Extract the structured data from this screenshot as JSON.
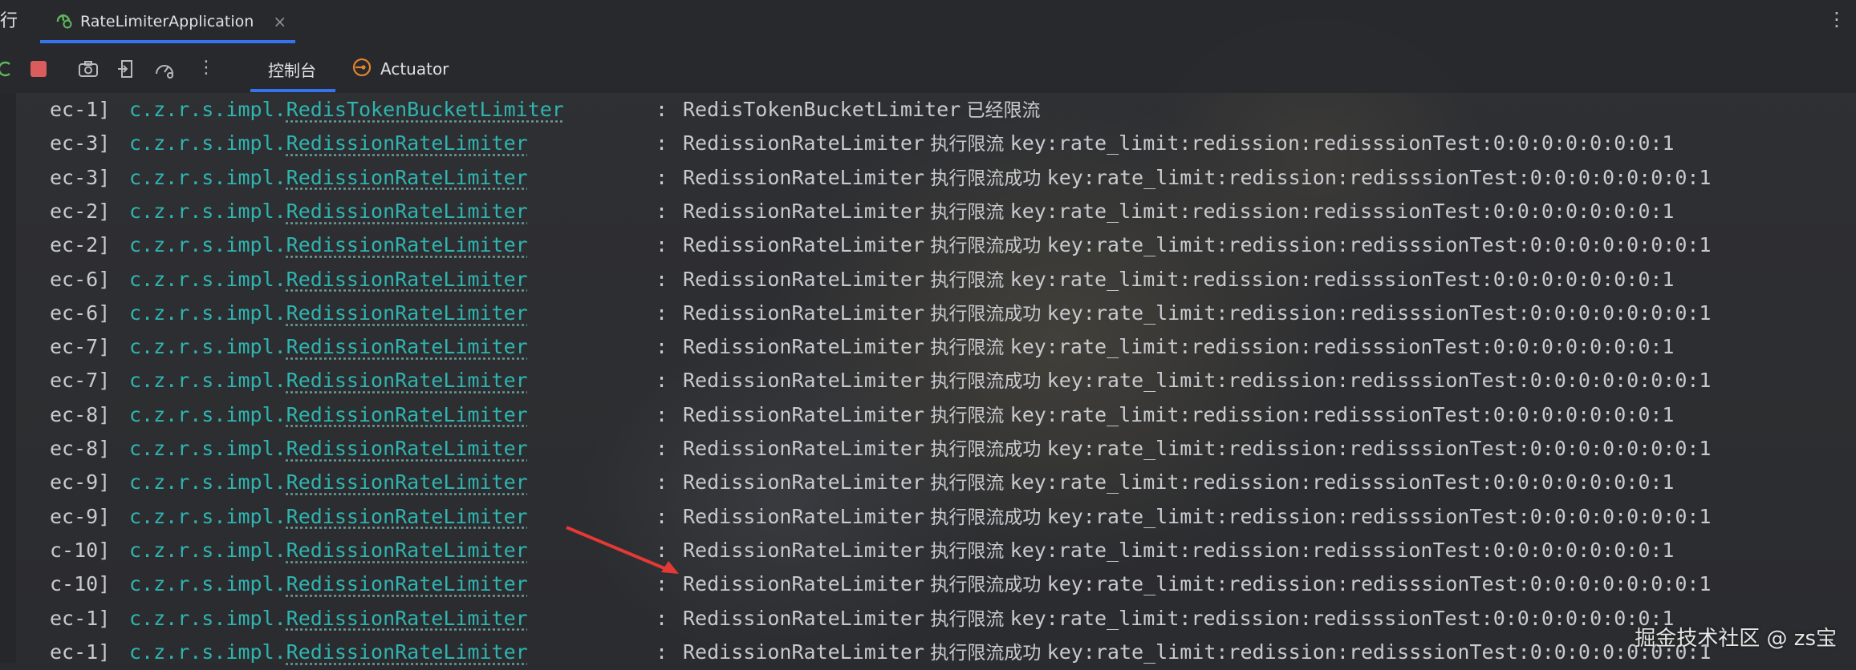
{
  "topbar": {
    "run_label": "行",
    "tab_title": "RateLimiterApplication",
    "tab_close": "×",
    "more": "⋮"
  },
  "toolbar": {
    "more": "⋮",
    "tabs": [
      {
        "label": "控制台",
        "active": true
      },
      {
        "label": "Actuator",
        "active": false
      }
    ]
  },
  "console": {
    "lines": [
      {
        "thread": "ec-1]",
        "pkg": "c.z.r.s.impl.",
        "cls": "RedisTokenBucketLimiter",
        "sep": ":",
        "msg": "RedisTokenBucketLimiter",
        "cjk": " 已经限流",
        "tail": ""
      },
      {
        "thread": "ec-3]",
        "pkg": "c.z.r.s.impl.",
        "cls": "RedissionRateLimiter",
        "sep": ":",
        "msg": "RedissionRateLimiter",
        "cjk": " 执行限流 ",
        "tail": "key:rate_limit:redission:redisssionTest:0:0:0:0:0:0:0:1"
      },
      {
        "thread": "ec-3]",
        "pkg": "c.z.r.s.impl.",
        "cls": "RedissionRateLimiter",
        "sep": ":",
        "msg": "RedissionRateLimiter",
        "cjk": " 执行限流成功 ",
        "tail": "key:rate_limit:redission:redisssionTest:0:0:0:0:0:0:0:1"
      },
      {
        "thread": "ec-2]",
        "pkg": "c.z.r.s.impl.",
        "cls": "RedissionRateLimiter",
        "sep": ":",
        "msg": "RedissionRateLimiter",
        "cjk": " 执行限流 ",
        "tail": "key:rate_limit:redission:redisssionTest:0:0:0:0:0:0:0:1"
      },
      {
        "thread": "ec-2]",
        "pkg": "c.z.r.s.impl.",
        "cls": "RedissionRateLimiter",
        "sep": ":",
        "msg": "RedissionRateLimiter",
        "cjk": " 执行限流成功 ",
        "tail": "key:rate_limit:redission:redisssionTest:0:0:0:0:0:0:0:1"
      },
      {
        "thread": "ec-6]",
        "pkg": "c.z.r.s.impl.",
        "cls": "RedissionRateLimiter",
        "sep": ":",
        "msg": "RedissionRateLimiter",
        "cjk": " 执行限流 ",
        "tail": "key:rate_limit:redission:redisssionTest:0:0:0:0:0:0:0:1"
      },
      {
        "thread": "ec-6]",
        "pkg": "c.z.r.s.impl.",
        "cls": "RedissionRateLimiter",
        "sep": ":",
        "msg": "RedissionRateLimiter",
        "cjk": " 执行限流成功 ",
        "tail": "key:rate_limit:redission:redisssionTest:0:0:0:0:0:0:0:1"
      },
      {
        "thread": "ec-7]",
        "pkg": "c.z.r.s.impl.",
        "cls": "RedissionRateLimiter",
        "sep": ":",
        "msg": "RedissionRateLimiter",
        "cjk": " 执行限流 ",
        "tail": "key:rate_limit:redission:redisssionTest:0:0:0:0:0:0:0:1"
      },
      {
        "thread": "ec-7]",
        "pkg": "c.z.r.s.impl.",
        "cls": "RedissionRateLimiter",
        "sep": ":",
        "msg": "RedissionRateLimiter",
        "cjk": " 执行限流成功 ",
        "tail": "key:rate_limit:redission:redisssionTest:0:0:0:0:0:0:0:1"
      },
      {
        "thread": "ec-8]",
        "pkg": "c.z.r.s.impl.",
        "cls": "RedissionRateLimiter",
        "sep": ":",
        "msg": "RedissionRateLimiter",
        "cjk": " 执行限流 ",
        "tail": "key:rate_limit:redission:redisssionTest:0:0:0:0:0:0:0:1"
      },
      {
        "thread": "ec-8]",
        "pkg": "c.z.r.s.impl.",
        "cls": "RedissionRateLimiter",
        "sep": ":",
        "msg": "RedissionRateLimiter",
        "cjk": " 执行限流成功 ",
        "tail": "key:rate_limit:redission:redisssionTest:0:0:0:0:0:0:0:1"
      },
      {
        "thread": "ec-9]",
        "pkg": "c.z.r.s.impl.",
        "cls": "RedissionRateLimiter",
        "sep": ":",
        "msg": "RedissionRateLimiter",
        "cjk": " 执行限流 ",
        "tail": "key:rate_limit:redission:redisssionTest:0:0:0:0:0:0:0:1"
      },
      {
        "thread": "ec-9]",
        "pkg": "c.z.r.s.impl.",
        "cls": "RedissionRateLimiter",
        "sep": ":",
        "msg": "RedissionRateLimiter",
        "cjk": " 执行限流成功 ",
        "tail": "key:rate_limit:redission:redisssionTest:0:0:0:0:0:0:0:1"
      },
      {
        "thread": "c-10]",
        "pkg": "c.z.r.s.impl.",
        "cls": "RedissionRateLimiter",
        "sep": ":",
        "msg": "RedissionRateLimiter",
        "cjk": " 执行限流 ",
        "tail": "key:rate_limit:redission:redisssionTest:0:0:0:0:0:0:0:1"
      },
      {
        "thread": "c-10]",
        "pkg": "c.z.r.s.impl.",
        "cls": "RedissionRateLimiter",
        "sep": ":",
        "msg": "RedissionRateLimiter",
        "cjk": " 执行限流成功 ",
        "tail": "key:rate_limit:redission:redisssionTest:0:0:0:0:0:0:0:1"
      },
      {
        "thread": "ec-1]",
        "pkg": "c.z.r.s.impl.",
        "cls": "RedissionRateLimiter",
        "sep": ":",
        "msg": "RedissionRateLimiter",
        "cjk": " 执行限流 ",
        "tail": "key:rate_limit:redission:redisssionTest:0:0:0:0:0:0:0:1"
      },
      {
        "thread": "ec-1]",
        "pkg": "c.z.r.s.impl.",
        "cls": "RedissionRateLimiter",
        "sep": ":",
        "msg": "RedissionRateLimiter",
        "cjk": " 执行限流成功 ",
        "tail": "key:rate_limit:redission:redisssionTest:0:0:0:0:0:0:0:1"
      }
    ]
  },
  "watermark": "掘金技术社区 @ zs宝"
}
